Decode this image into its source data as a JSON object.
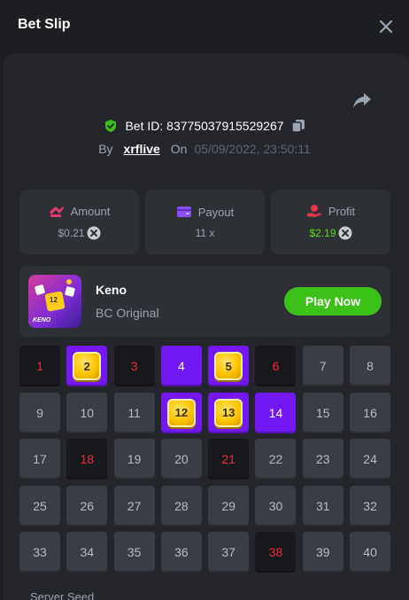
{
  "header": {
    "title": "Bet Slip",
    "close_icon": "close-icon"
  },
  "bet": {
    "id_label": "Bet ID: 83775037915529267",
    "by_label": "By",
    "user": "xrflive",
    "on_label": "On",
    "date": "05/09/2022, 23:50:11"
  },
  "stats": {
    "amount": {
      "label": "Amount",
      "value": "$0.21"
    },
    "payout": {
      "label": "Payout",
      "value": "11 x"
    },
    "profit": {
      "label": "Profit",
      "value": "$2.19"
    }
  },
  "game": {
    "name": "Keno",
    "subtitle": "BC Original",
    "button": "Play Now",
    "thumb_badge": "12",
    "thumb_text": "KENO"
  },
  "grid": {
    "cells": [
      {
        "n": "1",
        "s": "miss"
      },
      {
        "n": "2",
        "s": "hit"
      },
      {
        "n": "3",
        "s": "miss"
      },
      {
        "n": "4",
        "s": "pick"
      },
      {
        "n": "5",
        "s": "hit"
      },
      {
        "n": "6",
        "s": "miss"
      },
      {
        "n": "7",
        "s": "none"
      },
      {
        "n": "8",
        "s": "none"
      },
      {
        "n": "9",
        "s": "none"
      },
      {
        "n": "10",
        "s": "none"
      },
      {
        "n": "11",
        "s": "none"
      },
      {
        "n": "12",
        "s": "hit"
      },
      {
        "n": "13",
        "s": "hit"
      },
      {
        "n": "14",
        "s": "pick"
      },
      {
        "n": "15",
        "s": "none"
      },
      {
        "n": "16",
        "s": "none"
      },
      {
        "n": "17",
        "s": "none"
      },
      {
        "n": "18",
        "s": "miss"
      },
      {
        "n": "19",
        "s": "none"
      },
      {
        "n": "20",
        "s": "none"
      },
      {
        "n": "21",
        "s": "miss"
      },
      {
        "n": "22",
        "s": "none"
      },
      {
        "n": "23",
        "s": "none"
      },
      {
        "n": "24",
        "s": "none"
      },
      {
        "n": "25",
        "s": "none"
      },
      {
        "n": "26",
        "s": "none"
      },
      {
        "n": "27",
        "s": "none"
      },
      {
        "n": "28",
        "s": "none"
      },
      {
        "n": "29",
        "s": "none"
      },
      {
        "n": "30",
        "s": "none"
      },
      {
        "n": "31",
        "s": "none"
      },
      {
        "n": "32",
        "s": "none"
      },
      {
        "n": "33",
        "s": "none"
      },
      {
        "n": "34",
        "s": "none"
      },
      {
        "n": "35",
        "s": "none"
      },
      {
        "n": "36",
        "s": "none"
      },
      {
        "n": "37",
        "s": "none"
      },
      {
        "n": "38",
        "s": "miss"
      },
      {
        "n": "39",
        "s": "none"
      },
      {
        "n": "40",
        "s": "none"
      }
    ]
  },
  "footer": {
    "server_seed_label": "Server Seed"
  },
  "colors": {
    "accent_green": "#3bc117",
    "profit_green": "#5ddb1c",
    "pick_purple": "#7318f5",
    "miss_red": "#ed2e3f"
  }
}
